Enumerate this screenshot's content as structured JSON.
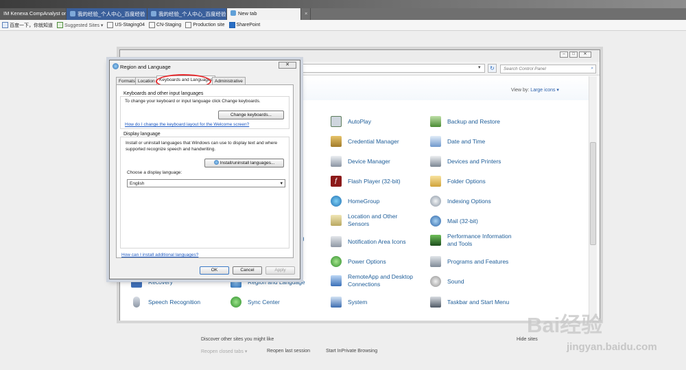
{
  "browser": {
    "tabs": [
      {
        "label": "IM Kenexa CompAnalyst on ...",
        "style": "dark"
      },
      {
        "label": "我的经验_个人中心_百度经验",
        "style": "blue"
      },
      {
        "label": "我的经验_个人中心_百度经验",
        "style": "blue"
      },
      {
        "label": "New tab",
        "style": "active"
      }
    ],
    "close_tab": "×",
    "favorites": [
      "百度一下，你就知道",
      "Suggested Sites ▾",
      "US-Staging04",
      "CN-Staging",
      "Production site",
      "SharePoint"
    ]
  },
  "control_panel": {
    "search_placeholder": "Search Control Panel",
    "view_by_label": "View by:",
    "view_by_value": "Large icons ▾",
    "partial_col1": [
      "ils",
      "t",
      "ter",
      "ing"
    ],
    "col1_bottom": [
      "Recovery",
      "Speech Recognition"
    ],
    "col2_bottom": [
      "Region and Language",
      "Sync Center"
    ],
    "col3": [
      "AutoPlay",
      "Credential Manager",
      "Device Manager",
      "Flash Player (32-bit)",
      "HomeGroup",
      "Location and Other Sensors",
      "Notification Area Icons",
      "Power Options",
      "RemoteApp and Desktop Connections",
      "System"
    ],
    "col4": [
      "Backup and Restore",
      "Date and Time",
      "Devices and Printers",
      "Folder Options",
      "Indexing Options",
      "Mail (32-bit)",
      "Performance Information and Tools",
      "Programs and Features",
      "Sound",
      "Taskbar and Start Menu"
    ]
  },
  "dialog": {
    "title": "Region and Language",
    "tabs": [
      "Formats",
      "Location",
      "Keyboards and Languages",
      "Administrative"
    ],
    "kb_group_title": "Keyboards and other input languages",
    "kb_text": "To change your keyboard or input language click Change keyboards.",
    "change_keyboards": "Change keyboards...",
    "kb_link": "How do I change the keyboard layout for the Welcome screen?",
    "display_group_title": "Display language",
    "display_text": "Install or uninstall languages that Windows can use to display text and where supported recognize speech and handwriting.",
    "install_button": "Install/uninstall languages...",
    "choose_label": "Choose a display language:",
    "language_value": "English",
    "install_link": "How can I install additional languages?",
    "ok": "OK",
    "cancel": "Cancel",
    "apply": "Apply"
  },
  "newtab": {
    "discover": "Discover other sites you might like",
    "hide_sites": "Hide sites",
    "reopen_closed": "Reopen closed tabs ▾",
    "reopen_last": "Reopen last session",
    "inprivate": "Start InPrivate Browsing"
  },
  "watermark": {
    "brand": "Bai经验",
    "url": "jingyan.baidu.com"
  }
}
